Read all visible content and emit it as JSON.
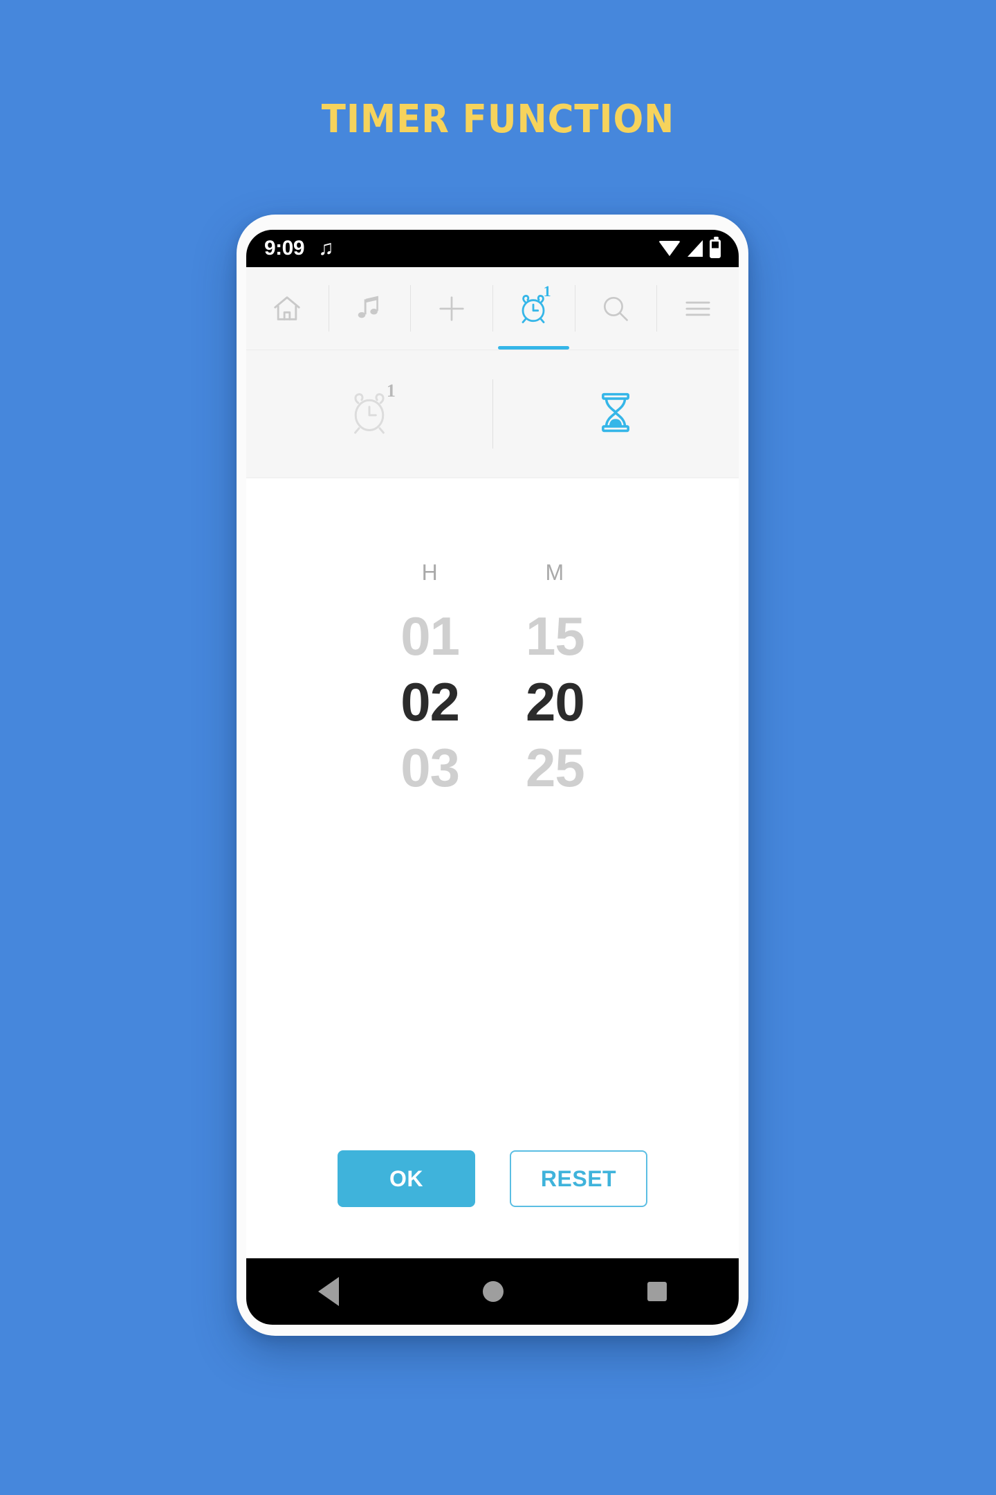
{
  "page": {
    "title": "TIMER FUNCTION",
    "background_color": "#4687DC",
    "title_color": "#F6D35C"
  },
  "status_bar": {
    "time": "9:09",
    "music_icon": "music-note-icon",
    "wifi_icon": "wifi-icon",
    "signal_icon": "signal-icon",
    "battery_icon": "battery-icon"
  },
  "nav_bar": {
    "items": [
      {
        "icon": "home-icon",
        "label": "Home",
        "active": false,
        "badge": ""
      },
      {
        "icon": "music-note-icon",
        "label": "Music",
        "active": false,
        "badge": ""
      },
      {
        "icon": "plus-icon",
        "label": "Add",
        "active": false,
        "badge": ""
      },
      {
        "icon": "alarm-clock-icon",
        "label": "Alarm",
        "active": true,
        "badge": "1"
      },
      {
        "icon": "search-icon",
        "label": "Search",
        "active": false,
        "badge": ""
      },
      {
        "icon": "hamburger-menu-icon",
        "label": "Menu",
        "active": false,
        "badge": ""
      }
    ],
    "accent_color": "#35B6E8",
    "inactive_color": "#C9C9C9"
  },
  "sub_tabs": {
    "items": [
      {
        "icon": "alarm-clock-icon",
        "label": "Alarm",
        "active": false,
        "badge": "1"
      },
      {
        "icon": "hourglass-icon",
        "label": "Timer",
        "active": true,
        "badge": ""
      }
    ]
  },
  "picker": {
    "columns": [
      {
        "label": "H",
        "name": "hours",
        "values": [
          "01",
          "02",
          "03"
        ],
        "selected_index": 1,
        "selected_value": "02"
      },
      {
        "label": "M",
        "name": "minutes",
        "values": [
          "15",
          "20",
          "25"
        ],
        "selected_index": 1,
        "selected_value": "20"
      }
    ]
  },
  "actions": {
    "ok_label": "OK",
    "reset_label": "RESET",
    "ok_color": "#3FB3DB",
    "reset_color": "#3FB3DB"
  },
  "android_nav": {
    "back": "back-triangle-icon",
    "home": "home-circle-icon",
    "recent": "recent-square-icon"
  }
}
